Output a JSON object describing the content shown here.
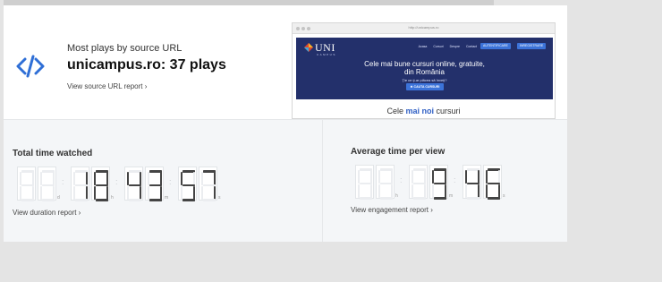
{
  "source": {
    "title": "Most plays by source URL",
    "main": "unicampus.ro: 37 plays",
    "report_link": "View source URL report ›"
  },
  "preview": {
    "url": "http://unicampus.ro",
    "logo_text": "UNI",
    "logo_sub": "CAMPUS",
    "nav": [
      "Acasa",
      "Cursuri",
      "Despre",
      "Contact"
    ],
    "nav_btn_1": "AUTENTIFICARE",
    "nav_btn_2": "INREGISTRARE",
    "hero_line1": "Cele mai bune cursuri online, gratuite,",
    "hero_line2": "din România",
    "hero_question": "Ţie ce ţi-ar plăcea să înveţi?",
    "hero_cta": "✱ CAUTA CURSURI",
    "section_pre": "Cele ",
    "section_hl": "mai noi",
    "section_post": " cursuri"
  },
  "total": {
    "title": "Total time watched",
    "digits": [
      "",
      "",
      "1",
      "8",
      "4",
      "3",
      "5",
      "7"
    ],
    "units": [
      "d",
      "h",
      "m",
      "s"
    ],
    "report_link": "View duration report ›"
  },
  "average": {
    "title": "Average time per view",
    "digits": [
      "",
      "",
      "",
      "9",
      "4",
      "6"
    ],
    "units": [
      "h",
      "m",
      "s"
    ],
    "report_link": "View engagement report ›"
  },
  "colors": {
    "accent": "#2f6fd6",
    "hero_bg": "#23306b",
    "digit_on": "#444444",
    "digit_off": "#ebedf0"
  }
}
